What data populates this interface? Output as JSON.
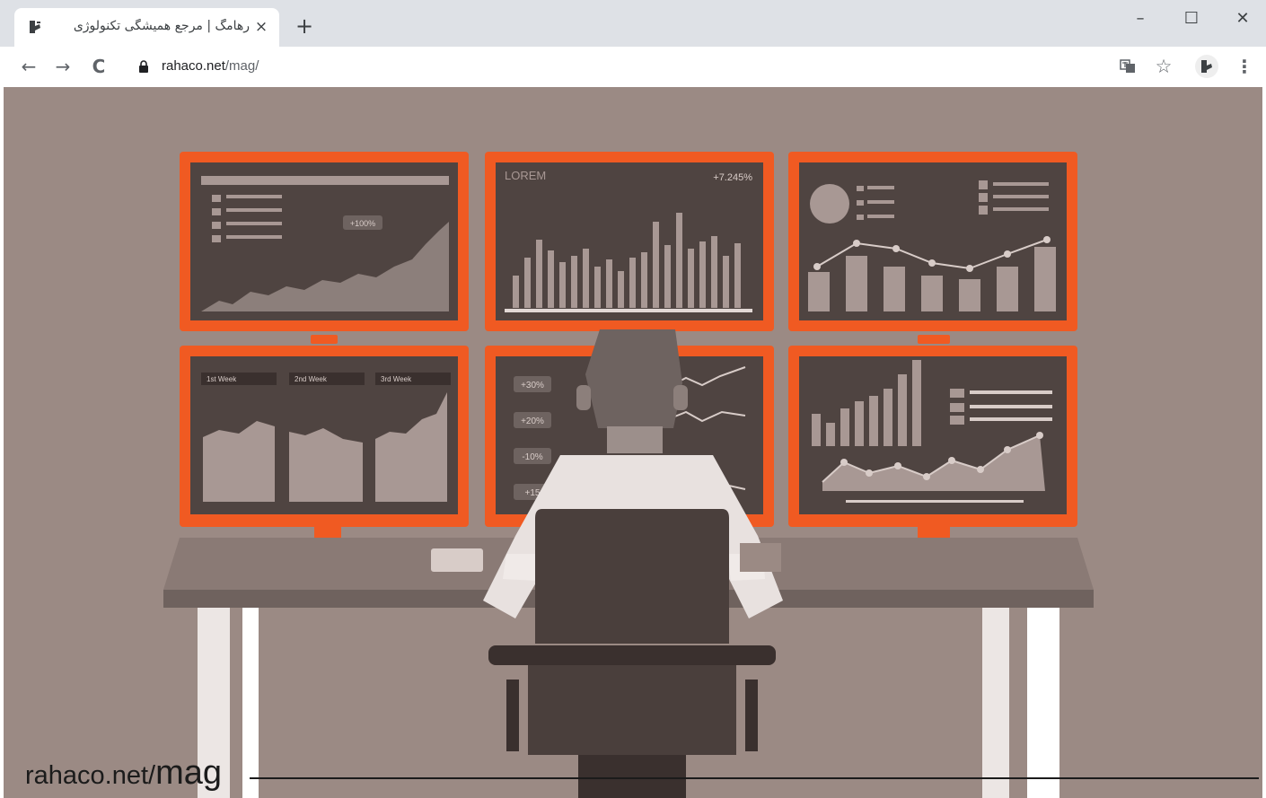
{
  "browser": {
    "tab": {
      "title": "رهامگ | مرجع همیشگی تکنولوژی",
      "close_glyph": "×"
    },
    "new_tab_glyph": "+",
    "window_controls": {
      "minimize": "–",
      "maximize": "☐",
      "close": "✕"
    },
    "nav": {
      "back": "←",
      "forward": "→",
      "reload": "C"
    },
    "address": {
      "host": "rahaco.net",
      "path": "/mag/"
    },
    "toolbar_icons": [
      "translate-icon",
      "star-icon",
      "profile-icon",
      "menu-icon"
    ],
    "menu_glyph": "⋮",
    "star_glyph": "☆"
  },
  "illustration": {
    "monitor_labels": {
      "lorem": "LOREM",
      "lorem_change": "+7.245%",
      "marker": "+100%",
      "week1": "1st Week",
      "week2": "2nd Week",
      "week3": "3rd Week",
      "pct1": "+30%",
      "pct2": "+20%",
      "pct3": "-10%",
      "pct4": "+15"
    }
  },
  "watermark": {
    "prefix": "rahaco.net/",
    "suffix": "mag"
  },
  "colors": {
    "accent": "#f05a22",
    "wall": "#9b8a84",
    "screen": "#4f4441",
    "desk": "#8a7a75"
  }
}
